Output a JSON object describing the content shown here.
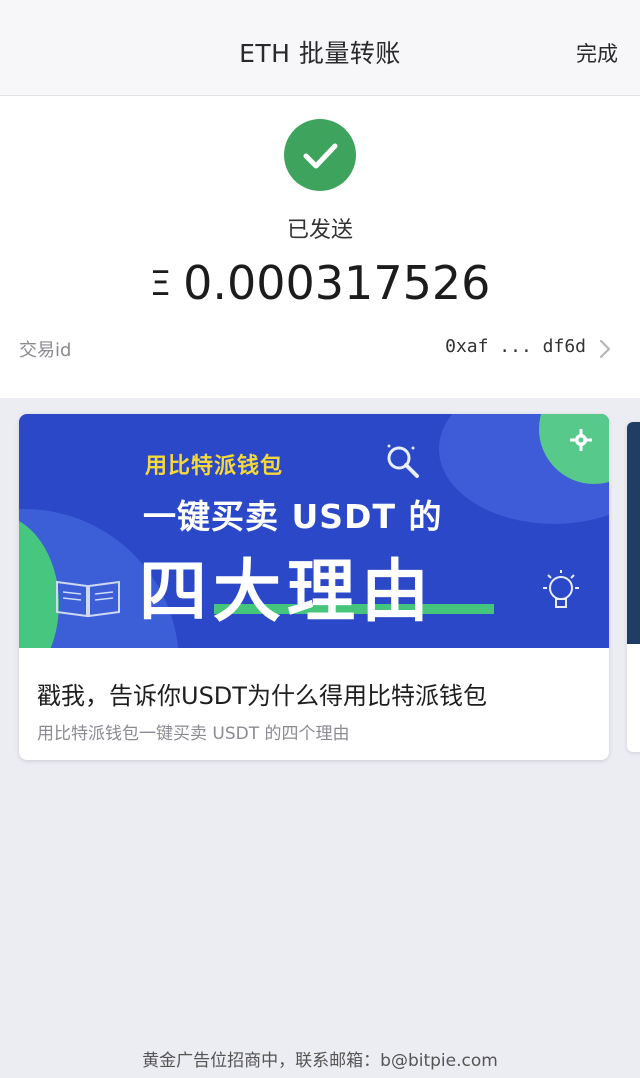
{
  "header": {
    "title": "ETH 批量转账",
    "done_label": "完成"
  },
  "status": {
    "icon": "check-icon",
    "text": "已发送",
    "currency_symbol": "Ξ",
    "amount": "0.000317526",
    "txid_label": "交易id",
    "txid_value": "0xaf ... df6d"
  },
  "ad_card": {
    "banner": {
      "subtitle": "用比特派钱包",
      "line1": "一键买卖 USDT 的",
      "line2": "四大理由"
    },
    "title": "戳我，告诉你USDT为什么得用比特派钱包",
    "subtitle": "用比特派钱包一键买卖 USDT 的四个理由"
  },
  "footer": {
    "text": "黄金广告位招商中，联系邮箱：b@bitpie.com"
  },
  "colors": {
    "success_green": "#3da35d",
    "banner_blue": "#2b48c8",
    "banner_yellow": "#f5d83a",
    "accent_green": "#45c57c",
    "page_background": "#ececf3"
  }
}
